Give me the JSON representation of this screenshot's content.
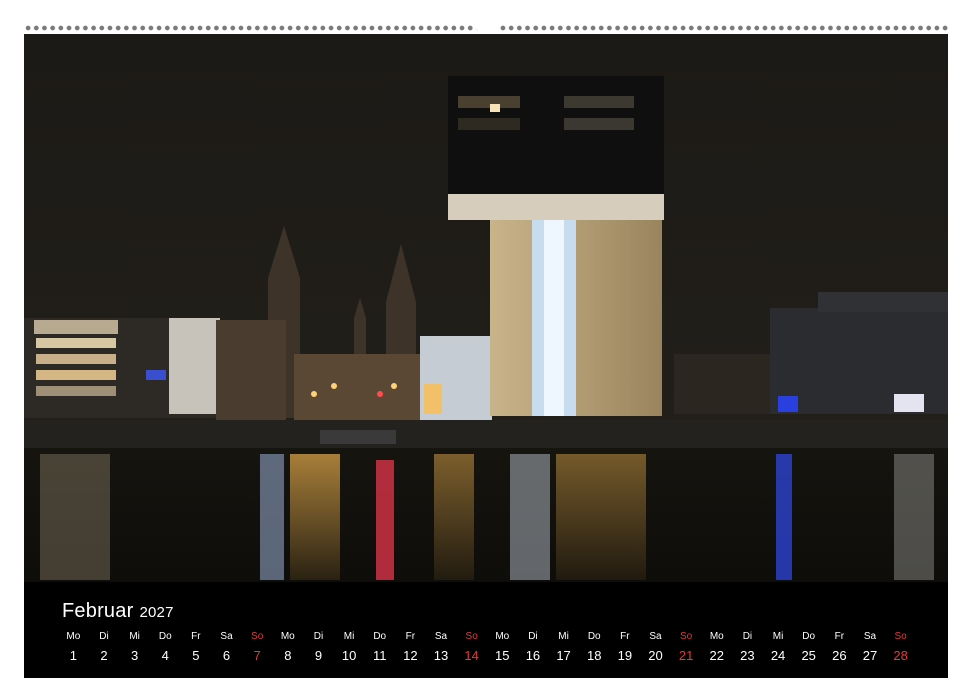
{
  "calendar": {
    "month": "Februar",
    "year": "2027",
    "days": [
      {
        "dow": "Mo",
        "num": "1",
        "sunday": false
      },
      {
        "dow": "Di",
        "num": "2",
        "sunday": false
      },
      {
        "dow": "Mi",
        "num": "3",
        "sunday": false
      },
      {
        "dow": "Do",
        "num": "4",
        "sunday": false
      },
      {
        "dow": "Fr",
        "num": "5",
        "sunday": false
      },
      {
        "dow": "Sa",
        "num": "6",
        "sunday": false
      },
      {
        "dow": "So",
        "num": "7",
        "sunday": true
      },
      {
        "dow": "Mo",
        "num": "8",
        "sunday": false
      },
      {
        "dow": "Di",
        "num": "9",
        "sunday": false
      },
      {
        "dow": "Mi",
        "num": "10",
        "sunday": false
      },
      {
        "dow": "Do",
        "num": "11",
        "sunday": false
      },
      {
        "dow": "Fr",
        "num": "12",
        "sunday": false
      },
      {
        "dow": "Sa",
        "num": "13",
        "sunday": false
      },
      {
        "dow": "So",
        "num": "14",
        "sunday": true
      },
      {
        "dow": "Mo",
        "num": "15",
        "sunday": false
      },
      {
        "dow": "Di",
        "num": "16",
        "sunday": false
      },
      {
        "dow": "Mi",
        "num": "17",
        "sunday": false
      },
      {
        "dow": "Do",
        "num": "18",
        "sunday": false
      },
      {
        "dow": "Fr",
        "num": "19",
        "sunday": false
      },
      {
        "dow": "Sa",
        "num": "20",
        "sunday": false
      },
      {
        "dow": "So",
        "num": "21",
        "sunday": true
      },
      {
        "dow": "Mo",
        "num": "22",
        "sunday": false
      },
      {
        "dow": "Di",
        "num": "23",
        "sunday": false
      },
      {
        "dow": "Mi",
        "num": "24",
        "sunday": false
      },
      {
        "dow": "Do",
        "num": "25",
        "sunday": false
      },
      {
        "dow": "Fr",
        "num": "26",
        "sunday": false
      },
      {
        "dow": "Sa",
        "num": "27",
        "sunday": false
      },
      {
        "dow": "So",
        "num": "28",
        "sunday": true
      }
    ]
  },
  "colors": {
    "sunday": "#e23a3a",
    "calendar_bg": "#000000",
    "sky": "#1d1b17"
  }
}
